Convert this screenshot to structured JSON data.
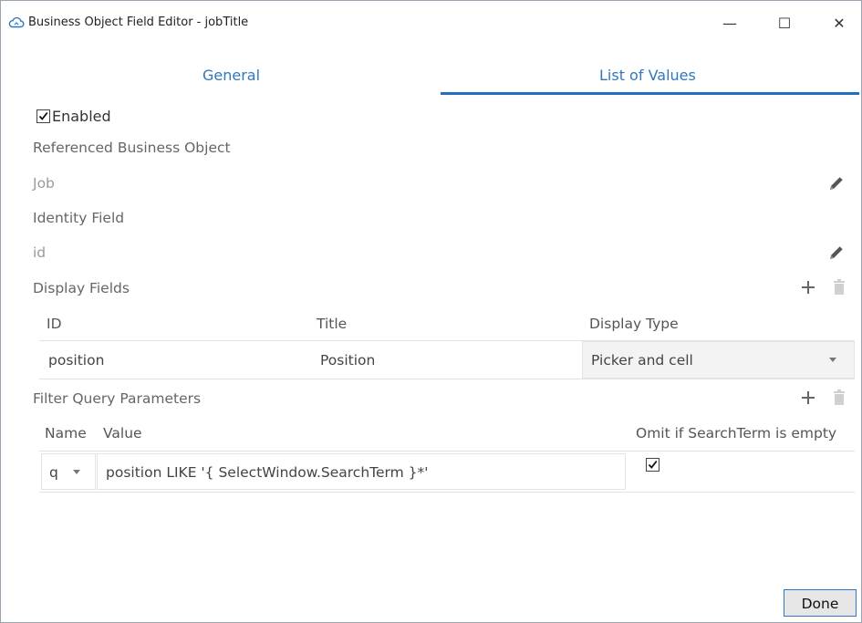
{
  "window": {
    "title": "Business Object Field Editor - jobTitle",
    "minimize": "—",
    "maximize": "☐",
    "close": "✕"
  },
  "tabs": [
    {
      "label": "General",
      "selected": false
    },
    {
      "label": "List of Values",
      "selected": true
    }
  ],
  "enabled": {
    "label": "Enabled",
    "checked": true
  },
  "referenced_business_object": {
    "label": "Referenced Business Object",
    "value": "Job"
  },
  "identity_field": {
    "label": "Identity Field",
    "value": "id"
  },
  "display_fields": {
    "label": "Display Fields",
    "columns": [
      "ID",
      "Title",
      "Display Type"
    ],
    "rows": [
      {
        "id": "position",
        "title": "Position",
        "display_type": "Picker and cell"
      }
    ]
  },
  "filter_query_parameters": {
    "label": "Filter Query Parameters",
    "columns": [
      "Name",
      "Value",
      "Omit if SearchTerm is empty"
    ],
    "rows": [
      {
        "name": "q",
        "value": "position LIKE '{ SelectWindow.SearchTerm }*'",
        "omit_if_empty": true
      }
    ]
  },
  "done_label": "Done",
  "icons": {
    "app": "cloud-icon",
    "edit": "pencil-icon",
    "add": "plus-icon",
    "delete": "trash-icon",
    "dropdown": "chevron-down-icon"
  },
  "colors": {
    "accent": "#1f6fc2",
    "tab_text": "#2f78bf",
    "label": "#666666",
    "disabled_value": "#9a9a9a"
  }
}
